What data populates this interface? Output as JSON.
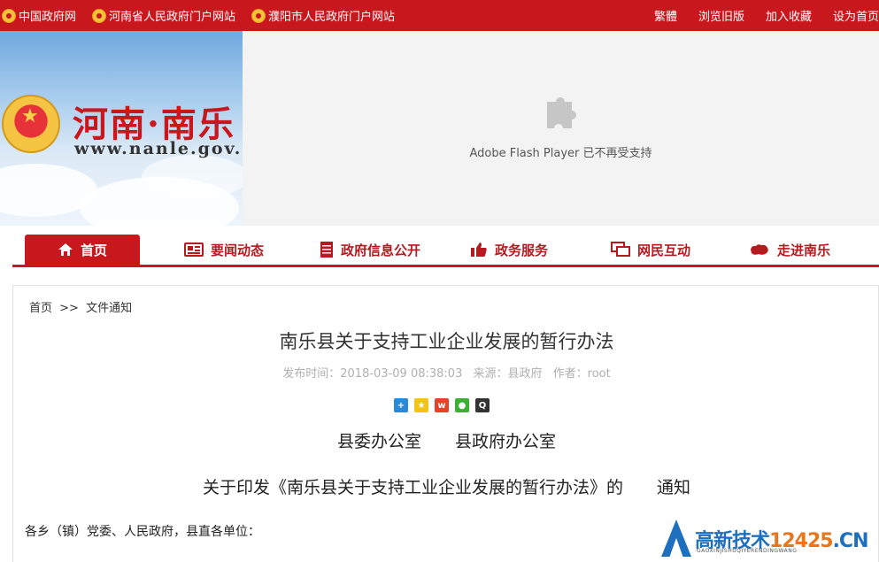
{
  "topbar": {
    "left_links": [
      "中国政府网",
      "河南省人民政府门户网站",
      "濮阳市人民政府门户网站"
    ],
    "right_links": [
      "繁體",
      "浏览旧版",
      "加入收藏",
      "设为首页"
    ]
  },
  "banner": {
    "site_title": "河南·南乐",
    "site_url": "www.nanle.gov.cn",
    "flash_message": "Adobe Flash Player 已不再受支持"
  },
  "nav": {
    "items": [
      "首页",
      "要闻动态",
      "政府信息公开",
      "政务服务",
      "网民互动",
      "走进南乐"
    ],
    "active_index": 0
  },
  "breadcrumb": {
    "home": "首页",
    "sep": ">>",
    "current": "文件通知"
  },
  "article": {
    "title": "南乐县关于支持工业企业发展的暂行办法",
    "publish_label": "发布时间：",
    "publish_time": "2018-03-09 08:38:03",
    "source_label": "来源：",
    "source": "县政府",
    "author_label": "作者：",
    "author": "root",
    "issuer_line": "县委办公室　　县政府办公室",
    "notice_line": "关于印发《南乐县关于支持工业企业发展的暂行办法》的　　通知",
    "greeting": "各乡（镇）党委、人民政府，县直各单位："
  },
  "share_icons": [
    "share-plus-icon",
    "qzone-icon",
    "weibo-icon",
    "wechat-icon",
    "qq-icon"
  ],
  "watermark": {
    "brand": "高新技术",
    "domain_num": "12425",
    "domain_tld": ".CN",
    "pinyin": "GAOXINJISHUQIYERENDINGWANG"
  },
  "colors": {
    "brand_red": "#c9171e",
    "meta_gray": "#b0b0b0",
    "watermark_blue": "#1f6fbf"
  }
}
